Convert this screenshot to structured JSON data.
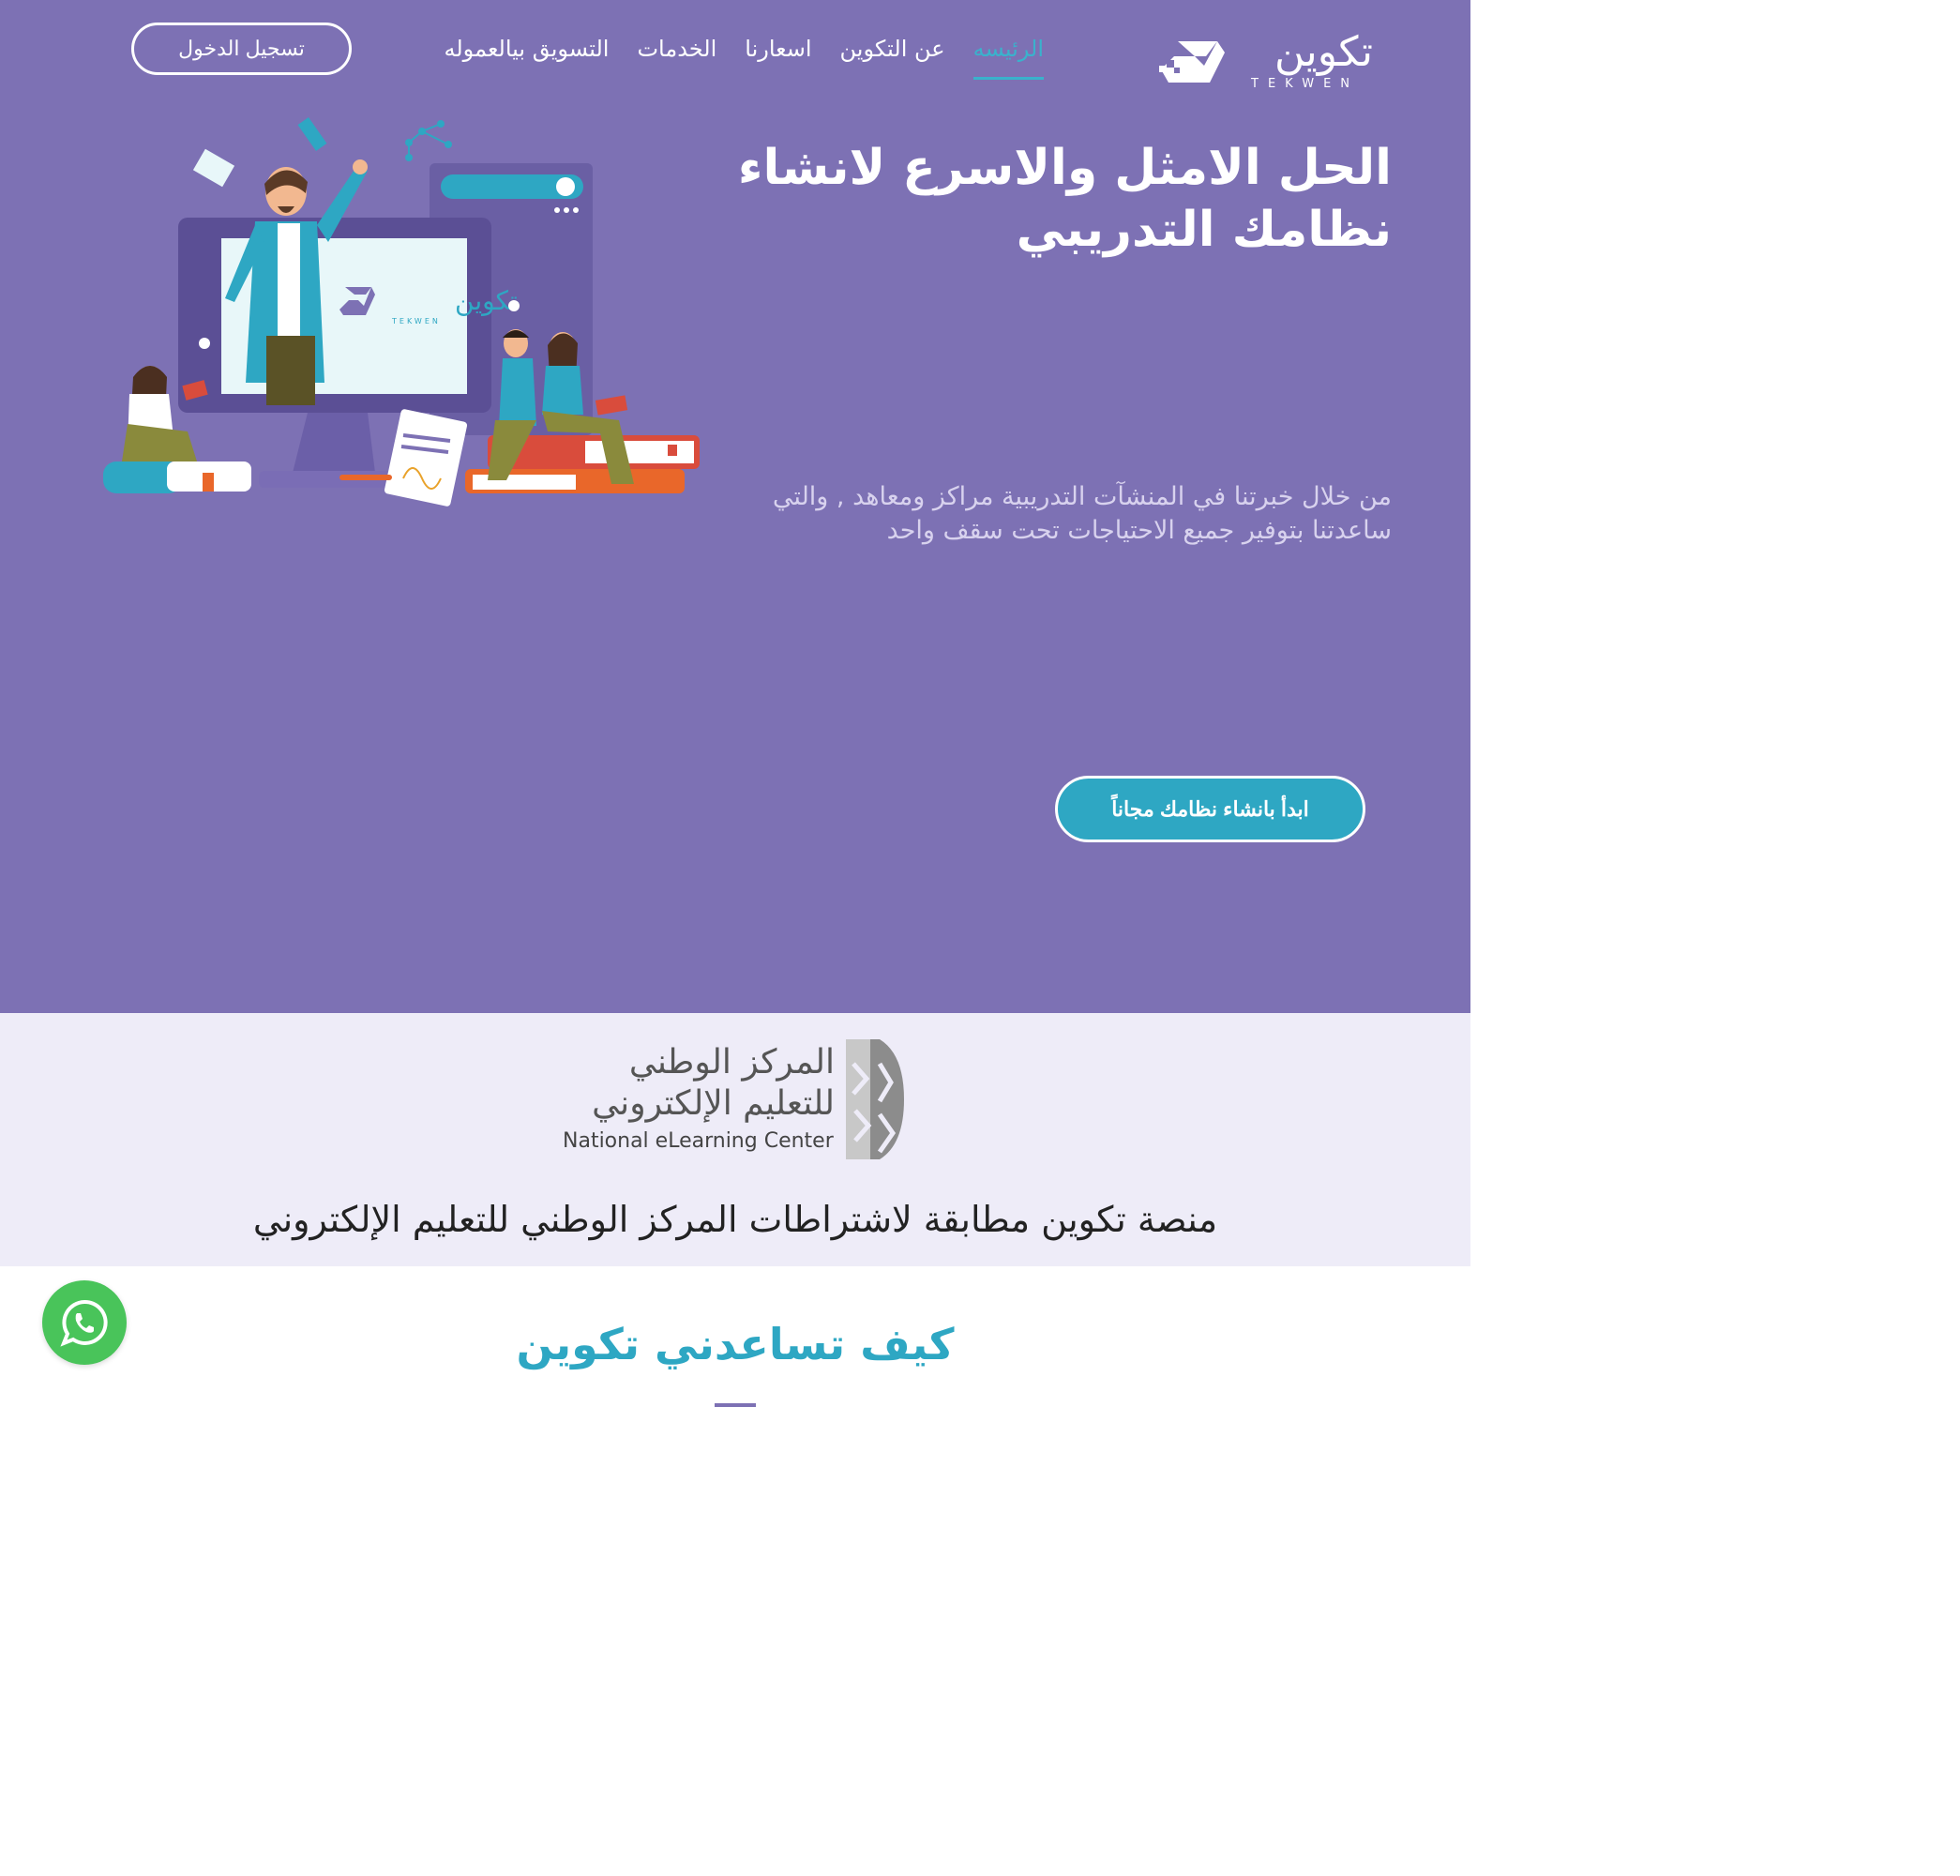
{
  "brand": {
    "name_ar": "تكوين",
    "name_en": "TEKWEN"
  },
  "nav": {
    "items": [
      {
        "label": "الرئيسه",
        "active": true
      },
      {
        "label": "عن التكوين",
        "active": false
      },
      {
        "label": "اسعارنا",
        "active": false
      },
      {
        "label": "الخدمات",
        "active": false
      },
      {
        "label": "التسويق بيالعموله",
        "active": false
      }
    ],
    "login_label": "تسجيل الدخول"
  },
  "hero": {
    "title_line1": "الحل الامثل والاسرع لانشاء",
    "title_line2": "نظامك التدريبي",
    "desc_line1": "من خلال خبرتنا في المنشآت التدريبية مراكز ومعاهد , والتي",
    "desc_line2": "ساعدتنا بتوفير جميع الاحتياجات تحت سقف واحد",
    "cta_label": "ابدأ بانشاء نظامك مجاناً",
    "screen_logo_ar": "تكوين",
    "screen_logo_en": "TEKWEN"
  },
  "nelc": {
    "name_ar_line1": "المركز الوطني",
    "name_ar_line2": "للتعليم الإلكتروني",
    "name_en": "National eLearning Center",
    "compliance_text": "منصة تكوين مطابقة لاشتراطات المركز الوطني للتعليم الإلكتروني"
  },
  "how": {
    "title": "كيف تساعدني تكوين"
  },
  "colors": {
    "hero_bg": "#7d71b4",
    "accent": "#2ea7c3",
    "band_bg": "#eeecf8",
    "whatsapp": "#49c45a"
  },
  "icons": {
    "whatsapp": "whatsapp-icon",
    "logo": "tekwen-logo-mark"
  }
}
